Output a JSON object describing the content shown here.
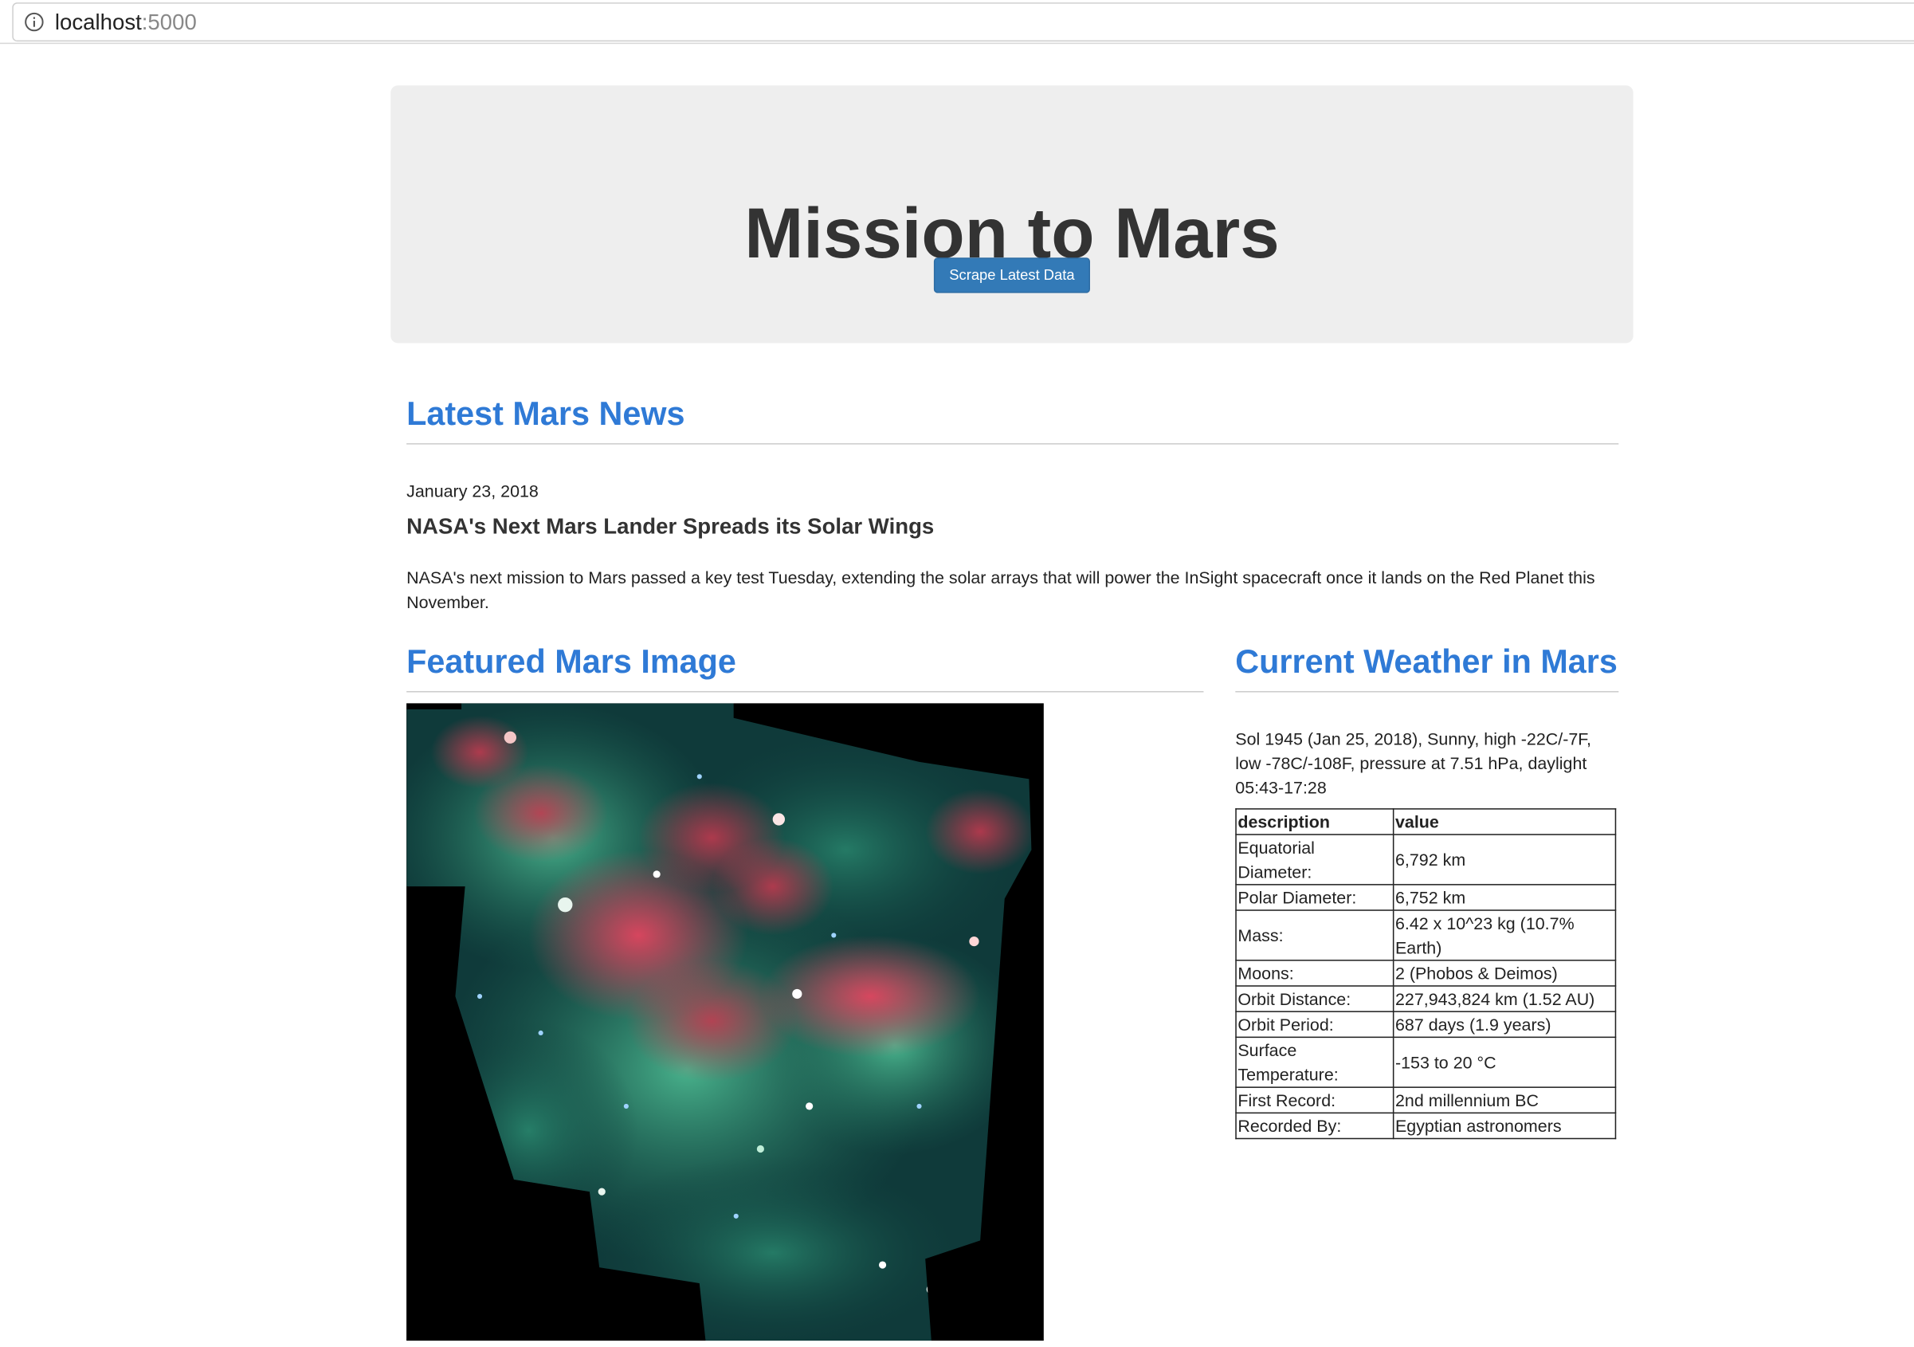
{
  "browser": {
    "url_host": "localhost",
    "url_port": ":5000"
  },
  "header": {
    "title": "Mission to Mars",
    "scrape_button": "Scrape Latest Data"
  },
  "news": {
    "heading": "Latest Mars News",
    "date": "January 23, 2018",
    "title": "NASA's Next Mars Lander Spreads its Solar Wings",
    "paragraph": "NASA's next mission to Mars passed a key test Tuesday, extending the solar arrays that will power the InSight spacecraft once it lands on the Red Planet this November."
  },
  "featured_image": {
    "heading": "Featured Mars Image"
  },
  "weather": {
    "heading": "Current Weather in Mars",
    "text": "Sol 1945 (Jan 25, 2018), Sunny, high -22C/-7F, low -78C/-108F, pressure at 7.51 hPa, daylight 05:43-17:28"
  },
  "facts": {
    "columns": [
      "description",
      "value"
    ],
    "rows": [
      [
        "Equatorial Diameter:",
        "6,792 km"
      ],
      [
        "Polar Diameter:",
        "6,752 km"
      ],
      [
        "Mass:",
        "6.42 x 10^23 kg (10.7% Earth)"
      ],
      [
        "Moons:",
        "2 (Phobos & Deimos)"
      ],
      [
        "Orbit Distance:",
        "227,943,824 km (1.52 AU)"
      ],
      [
        "Orbit Period:",
        "687 days (1.9 years)"
      ],
      [
        "Surface Temperature:",
        "-153 to 20 °C"
      ],
      [
        "First Record:",
        "2nd millennium BC"
      ],
      [
        "Recorded By:",
        "Egyptian astronomers"
      ]
    ]
  },
  "colors": {
    "accent_heading": "#2f7ad6",
    "button": "#337ab7",
    "jumbotron_bg": "#eeeeee"
  }
}
